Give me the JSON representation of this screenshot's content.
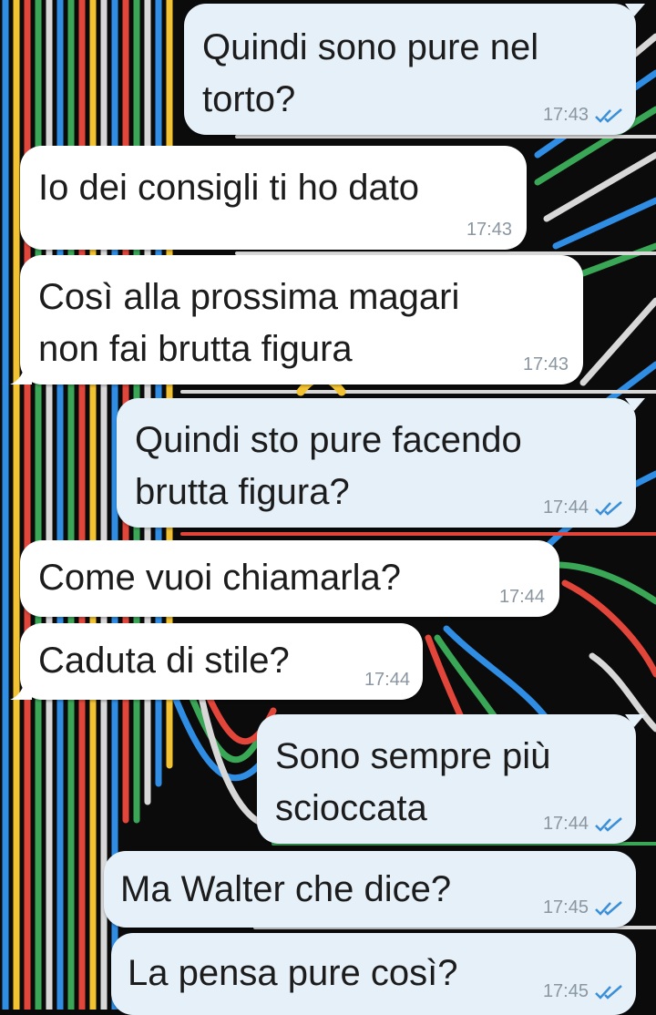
{
  "messages": [
    {
      "text": "Quindi sono pure nel\ntorto?",
      "time": "17:43",
      "direction": "out",
      "read_receipt": "double-check-read"
    },
    {
      "text": "Io dei consigli ti ho dato",
      "time": "17:43",
      "direction": "in"
    },
    {
      "text": "Così alla prossima magari\nnon fai brutta figura",
      "time": "17:43",
      "direction": "in"
    },
    {
      "text": "Quindi sto pure facendo\nbrutta figura?",
      "time": "17:44",
      "direction": "out",
      "read_receipt": "double-check-read"
    },
    {
      "text": "Come vuoi chiamarla?",
      "time": "17:44",
      "direction": "in"
    },
    {
      "text": "Caduta di stile?",
      "time": "17:44",
      "direction": "in"
    },
    {
      "text": "Sono sempre più\nscioccata",
      "time": "17:44",
      "direction": "out",
      "read_receipt": "double-check-read"
    },
    {
      "text": "Ma Walter che dice?",
      "time": "17:45",
      "direction": "out",
      "read_receipt": "double-check-read"
    },
    {
      "text": "La pensa pure così?",
      "time": "17:45",
      "direction": "out",
      "read_receipt": "double-check-read"
    }
  ],
  "colors": {
    "incoming_bubble": "#ffffff",
    "outgoing_bubble": "#e6f0f9",
    "timestamp": "#8a96a0",
    "read_tick": "#3b8fd6"
  }
}
